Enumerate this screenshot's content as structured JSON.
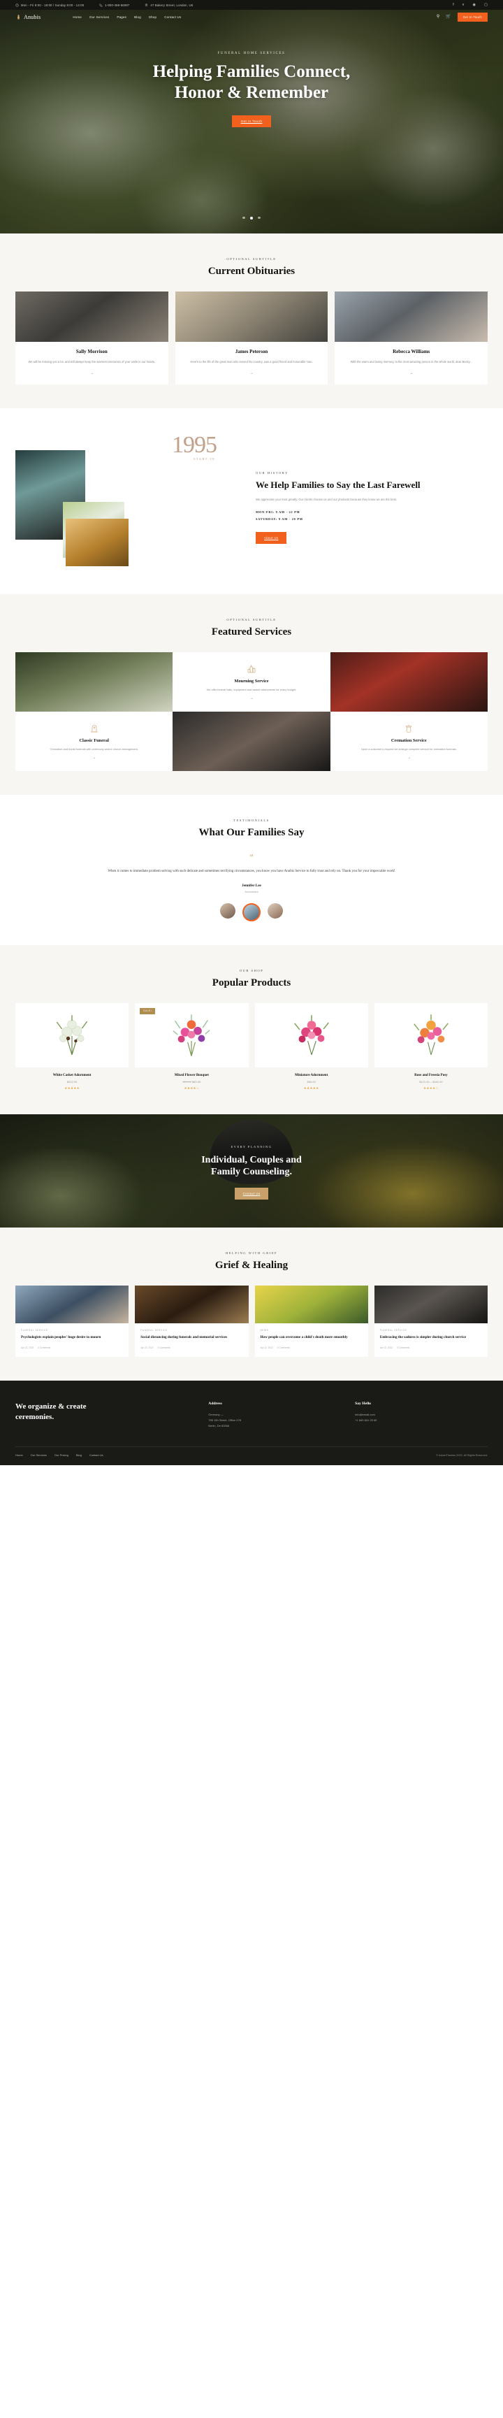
{
  "topbar": {
    "hours": "Mon - Fri 8:00 - 18:00 / Sunday 8:00 - 14:00",
    "phone": "1-800-458-56987",
    "address": "47 Bakery Street, London, UK",
    "socials": [
      "facebook-icon",
      "twitter-icon",
      "dribbble-icon",
      "instagram-icon"
    ]
  },
  "nav": {
    "brand": "Anubis",
    "items": [
      "Home",
      "Our Services",
      "Pages",
      "Blog",
      "Shop",
      "Contact Us"
    ],
    "search_icon": "search-icon",
    "cart_icon": "cart-icon",
    "cta": "Get In Touch"
  },
  "hero": {
    "subtitle": "FUNERAL HOME SERVICES",
    "title_line1": "Helping Families Connect,",
    "title_line2": "Honor & Remember",
    "cta": "Get In Touch",
    "slides": 3,
    "active_slide": 2
  },
  "obituaries": {
    "eyebrow": "OPTIONAL SUBTITLE",
    "title": "Current Obituaries",
    "items": [
      {
        "name": "Sally Morrison",
        "text": "We will be missing you a lot, and will always keep the warmest memories of your smile in our hearts.",
        "arrow": "→"
      },
      {
        "name": "James Peterson",
        "text": "Here's to the life of the great man who served his country, was a good friend and honorable man.",
        "arrow": "→"
      },
      {
        "name": "Rebecca Williams",
        "text": "With the warm and loving memory, to the most amazing person in the whole world, dear Becky...",
        "arrow": "→"
      }
    ]
  },
  "history": {
    "year": "1995",
    "year_label": "START IN",
    "eyebrow": "OUR HISTORY",
    "title": "We Help Families to Say the Last Farewell",
    "text": "We appreciate your trust greatly. Our clients choose us and our products because they know we are the best.",
    "hours": [
      "MON-FRI: 9 AM - 22 PM",
      "SATURDAY: 9 AM - 20 PM"
    ],
    "button": "About Us"
  },
  "services": {
    "eyebrow": "OPTIONAL SUBTITLE",
    "title": "Featured Services",
    "items": [
      {
        "name": "Mourning Service",
        "desc": "We offer funeral halls, equipment and casket adornments for every budget.",
        "icon": "candles-icon",
        "arrow": "→"
      },
      {
        "name": "Classic Funeral",
        "desc": "Cremation and burial funerals with ceremony and/or church arrangement.",
        "icon": "headstone-icon",
        "arrow": "→"
      },
      {
        "name": "Cremation Service",
        "desc": "Upon a customer's request we arrange complete service for cremation funerals.",
        "icon": "urn-icon",
        "arrow": "→"
      }
    ]
  },
  "testimonials": {
    "eyebrow": "TESTIMONIALS",
    "quote_glyph": "”",
    "body": "When it comes to immediate problem solving with such delicate and sometimes terrifying circumstances, you know you have Anubis Service to fully trust and rely on. Thank you for your impeccable work!",
    "title": "What Our Families Say",
    "author": "Jennifer Lee",
    "role": "Accountant",
    "avatars": [
      "avatar-1",
      "avatar-2",
      "avatar-3"
    ]
  },
  "products": {
    "eyebrow": "OUR SHOP",
    "title": "Popular Products",
    "items": [
      {
        "name": "White Casket Adornment",
        "price": "$202.00",
        "old_price": "",
        "badge": "",
        "stars": "★★★★★"
      },
      {
        "name": "Mixed Flower Bouquet",
        "price": "$89.00",
        "old_price": "$99.00",
        "badge": "SALE!",
        "stars": "★★★★☆"
      },
      {
        "name": "Miniature Adornment",
        "price": "$69.00",
        "old_price": "",
        "badge": "",
        "stars": "★★★★★"
      },
      {
        "name": "Rose and Freesia Posy",
        "price": "$121.00 – $182.00",
        "old_price": "",
        "badge": "",
        "stars": "★★★★☆"
      }
    ]
  },
  "cta_banner": {
    "eyebrow": "EVERY PLANNING",
    "title_line1": "Individual, Couples and",
    "title_line2": "Family Counseling.",
    "button": "Contact Us"
  },
  "blog": {
    "eyebrow": "HELPING WITH GRIEF",
    "title": "Grief & Healing",
    "items": [
      {
        "cat": "FUNERAL SERVICE",
        "title": "Psychologists explain peoples' huge desire to mourn",
        "date": "Apr 22, 2022",
        "comments": "0 Comments"
      },
      {
        "cat": "FUNERAL SERVICE",
        "title": "Social distancing during funerals and memorial services",
        "date": "Apr 22, 2022",
        "comments": "0 Comments"
      },
      {
        "cat": "NEWS",
        "title": "How people can overcome a child's death more smoothly",
        "date": "Apr 22, 2022",
        "comments": "0 Comments"
      },
      {
        "cat": "FUNERAL SERVICE",
        "title": "Embracing the sadness is simpler during church service",
        "date": "Apr 22, 2022",
        "comments": "0 Comments"
      }
    ]
  },
  "footer": {
    "heading_line1": "We organize & create",
    "heading_line2": "ceremonies.",
    "address_title": "Address",
    "address_lines": [
      "Germany —",
      "785 15h Street, Office 478",
      "Berlin, De 81566"
    ],
    "contact_title": "Say Hello",
    "contact_email": "info@email.com",
    "contact_phone": "+1 840 841 25 69",
    "links": [
      "Home",
      "Our Services",
      "Our Pricing",
      "Blog",
      "Contact Us"
    ],
    "copyright": "© AxiomThemes 2022. All Rights Reserved."
  }
}
